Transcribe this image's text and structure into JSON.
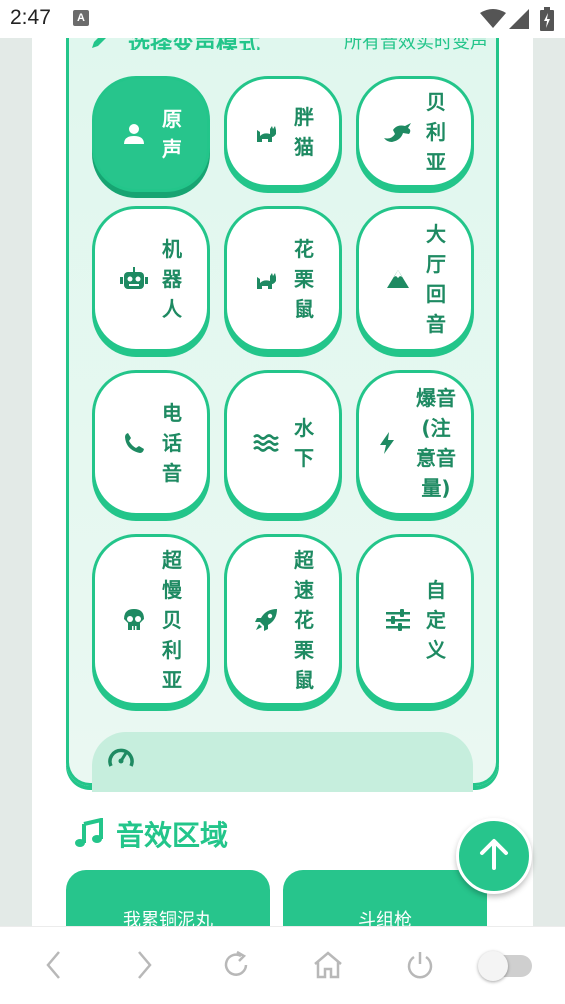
{
  "status_bar": {
    "time": "2:47",
    "notification_icon": "text-a-icon",
    "notification_label": "A",
    "icons": [
      "wifi-icon",
      "signal-icon",
      "battery-charging-icon"
    ]
  },
  "voice_panel": {
    "title": "选择变声模式",
    "subtitle": "所有音效实时变声",
    "title_icon": "pencil-icon",
    "buttons": [
      {
        "label": "原声",
        "icon": "user-icon",
        "active": true
      },
      {
        "label": "胖猫",
        "icon": "cat-icon",
        "active": false
      },
      {
        "label": "贝利亚",
        "icon": "dragon-icon",
        "active": false
      },
      {
        "label": "机器人",
        "icon": "robot-icon",
        "active": false
      },
      {
        "label": "花栗鼠",
        "icon": "cat-icon",
        "active": false
      },
      {
        "label": "大厅回音",
        "icon": "mountain-icon",
        "active": false
      },
      {
        "label": "电话音",
        "icon": "phone-icon",
        "active": false
      },
      {
        "label": "水下",
        "icon": "water-icon",
        "active": false
      },
      {
        "label": "爆音(注意音量)",
        "icon": "bolt-icon",
        "active": false
      },
      {
        "label": "超慢贝利亚",
        "icon": "skull-icon",
        "active": false
      },
      {
        "label": "超速花栗鼠",
        "icon": "rocket-icon",
        "active": false
      },
      {
        "label": "自定义",
        "icon": "sliders-icon",
        "active": false
      }
    ],
    "partial_row_icon": "gauge-icon"
  },
  "sound_effects": {
    "title": "音效区域",
    "icon": "music-note-icon",
    "cards": [
      {
        "label": "我累铜泥丸"
      },
      {
        "label": "斗组枪"
      }
    ]
  },
  "scroll_top": {
    "icon": "arrow-up-icon"
  },
  "browser_nav": {
    "items": [
      "back-icon",
      "forward-icon",
      "reload-icon",
      "home-icon",
      "power-icon",
      "toggle-switch"
    ]
  },
  "colors": {
    "accent": "#23c58a",
    "accent_dark": "#17a472",
    "label_text": "#1e8a62",
    "panel_bg": "#e0f7ee",
    "page_bg": "#e3eae7"
  }
}
